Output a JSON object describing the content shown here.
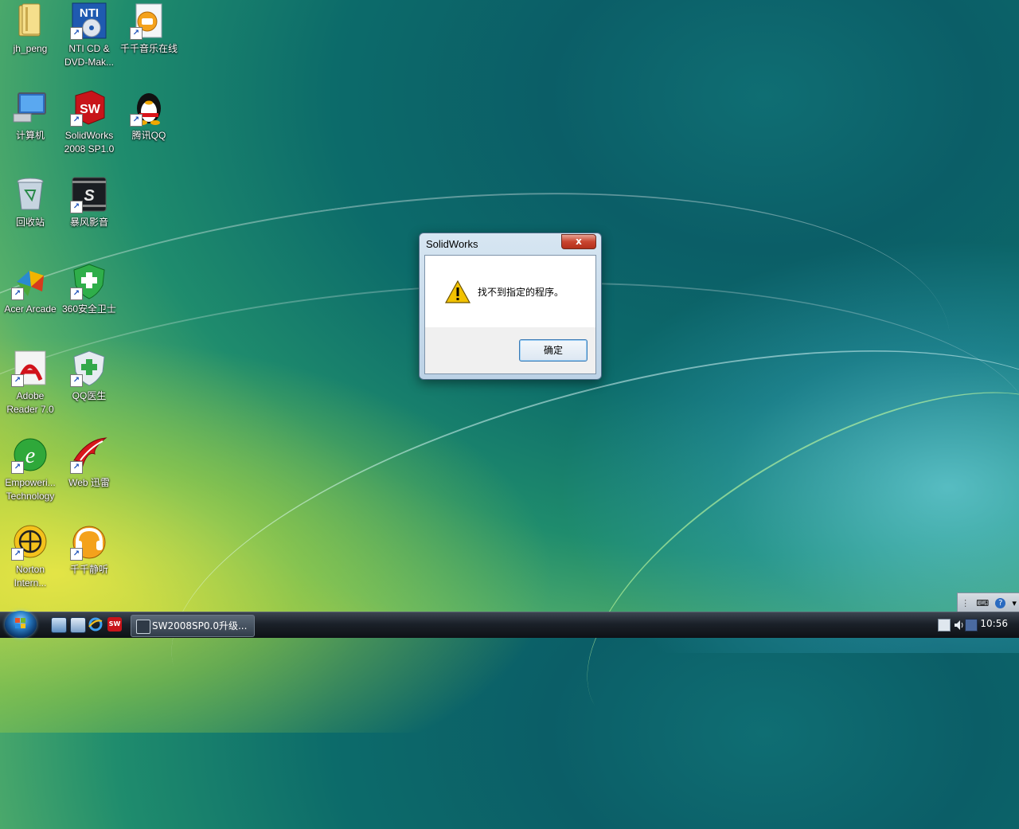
{
  "desktop_icons": [
    {
      "label": "jh_peng",
      "icon": "user-folder-icon",
      "shortcut": false
    },
    {
      "label": "NTI CD & DVD-Mak...",
      "icon": "nti-disc-icon",
      "shortcut": true
    },
    {
      "label": "千千音乐在线",
      "icon": "music-online-icon",
      "shortcut": true
    },
    {
      "label": "计算机",
      "icon": "computer-icon",
      "shortcut": false
    },
    {
      "label": "SolidWorks 2008 SP1.0",
      "icon": "solidworks-icon",
      "shortcut": true
    },
    {
      "label": "腾讯QQ",
      "icon": "qq-penguin-icon",
      "shortcut": true
    },
    {
      "label": "回收站",
      "icon": "recycle-bin-icon",
      "shortcut": false
    },
    {
      "label": "暴风影音",
      "icon": "storm-player-icon",
      "shortcut": true
    },
    {
      "label": "Acer Arcade",
      "icon": "acer-arcade-icon",
      "shortcut": true
    },
    {
      "label": "360安全卫士",
      "icon": "360-shield-icon",
      "shortcut": true
    },
    {
      "label": "Adobe Reader 7.0",
      "icon": "adobe-reader-icon",
      "shortcut": true
    },
    {
      "label": "QQ医生",
      "icon": "qq-doctor-icon",
      "shortcut": true
    },
    {
      "label": "Empoweri... Technology",
      "icon": "empowering-tech-icon",
      "shortcut": true
    },
    {
      "label": "Web 迅雷",
      "icon": "thunder-icon",
      "shortcut": true
    },
    {
      "label": "Norton Intern...",
      "icon": "norton-icon",
      "shortcut": true
    },
    {
      "label": "千千静听",
      "icon": "ttplayer-icon",
      "shortcut": true
    }
  ],
  "dialog": {
    "title": "SolidWorks",
    "close_label": "x",
    "message": "找不到指定的程序。",
    "ok_label": "确定",
    "icon": "warning-icon"
  },
  "taskbar": {
    "start_icon": "windows-orb-icon",
    "quicklaunch": [
      "show-desktop-icon",
      "switch-windows-icon",
      "internet-explorer-icon",
      "solidworks-icon"
    ],
    "task_button_label": "SW2008SP0.0升级...",
    "tray_icons": [
      "network-icon",
      "speaker-icon",
      "notification-icon"
    ],
    "clock": "10:56"
  },
  "colors": {
    "dialog_close": "#c9452f",
    "taskbar": "#1b2129",
    "warning": "#f2c200"
  }
}
